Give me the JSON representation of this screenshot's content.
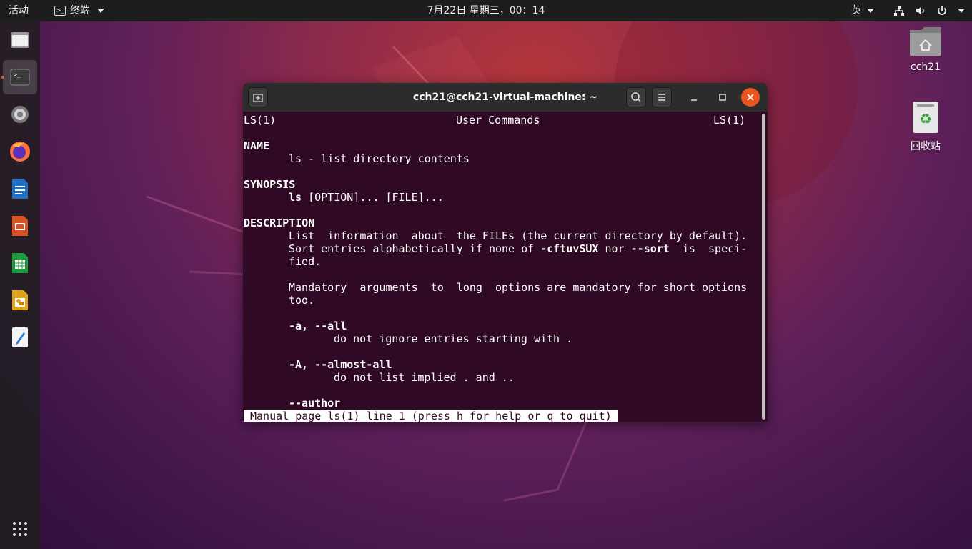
{
  "topbar": {
    "activities": "活动",
    "app_name": "终端",
    "clock": "7月22日 星期三，00：14",
    "input_method": "英"
  },
  "dock": {
    "items": [
      "files",
      "terminal",
      "settings",
      "firefox",
      "libreoffice-writer",
      "libreoffice-impress",
      "libreoffice-calc",
      "libreoffice-draw",
      "text-editor"
    ],
    "active": "terminal"
  },
  "desktop": {
    "home_label": "cch21",
    "trash_label": "回收站"
  },
  "window": {
    "title": "cch21@cch21-virtual-machine: ~"
  },
  "man": {
    "header_left": "LS(1)",
    "header_center": "User Commands",
    "header_right": "LS(1)",
    "name_heading": "NAME",
    "name_text": "ls - list directory contents",
    "synopsis_heading": "SYNOPSIS",
    "syn_cmd": "ls",
    "syn_option": "OPTION",
    "syn_file": "FILE",
    "syn_dots": "...",
    "description_heading": "DESCRIPTION",
    "desc_line1": "List  information  about  the FILEs (the current directory by default).",
    "desc_line2_a": "Sort entries alphabetically if none of ",
    "desc_line2_b": "-cftuvSUX",
    "desc_line2_c": " nor ",
    "desc_line2_d": "--sort",
    "desc_line2_e": "  is  speci‐",
    "desc_line3": "fied.",
    "mand_line1": "Mandatory  arguments  to  long  options are mandatory for short options",
    "mand_line2": "too.",
    "opt_a": "-a, --all",
    "opt_a_desc": "do not ignore entries starting with .",
    "opt_A": "-A, --almost-all",
    "opt_A_desc": "do not list implied . and ..",
    "opt_author": "--author",
    "status_line": "Manual page ls(1) line 1 (press h for help or q to quit)"
  }
}
